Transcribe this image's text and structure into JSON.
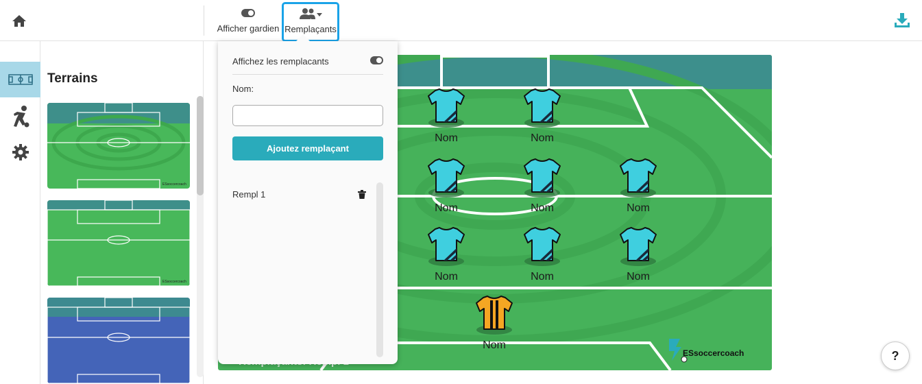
{
  "toolbar": {
    "home_icon": "home-icon",
    "show_goalkeeper_label": "Afficher gardien",
    "substitutes_label": "Remplaçants",
    "download_icon": "download-icon"
  },
  "sidebar": {
    "title": "Terrains",
    "rail": [
      "field-icon",
      "player-icon",
      "gear-icon"
    ]
  },
  "popup": {
    "title": "Affichez les remplacants",
    "name_label": "Nom:",
    "name_value": "",
    "add_button": "Ajoutez remplaçant",
    "substitutes": [
      "Rempl 1"
    ]
  },
  "field": {
    "players": [
      "Nom",
      "Nom",
      "Nom",
      "Nom",
      "Nom",
      "Nom",
      "Nom",
      "Nom",
      "Nom"
    ],
    "brand": "ESsoccercoach",
    "bottom_label": "Remplaçants: Rempl 1"
  },
  "help": {
    "label": "?"
  },
  "colors": {
    "accent": "#2aabbb",
    "highlight": "#1aa3e8",
    "field_green": "#49b65a",
    "jersey_cyan": "#3fcfdf",
    "keeper_orange": "#f5a623"
  }
}
